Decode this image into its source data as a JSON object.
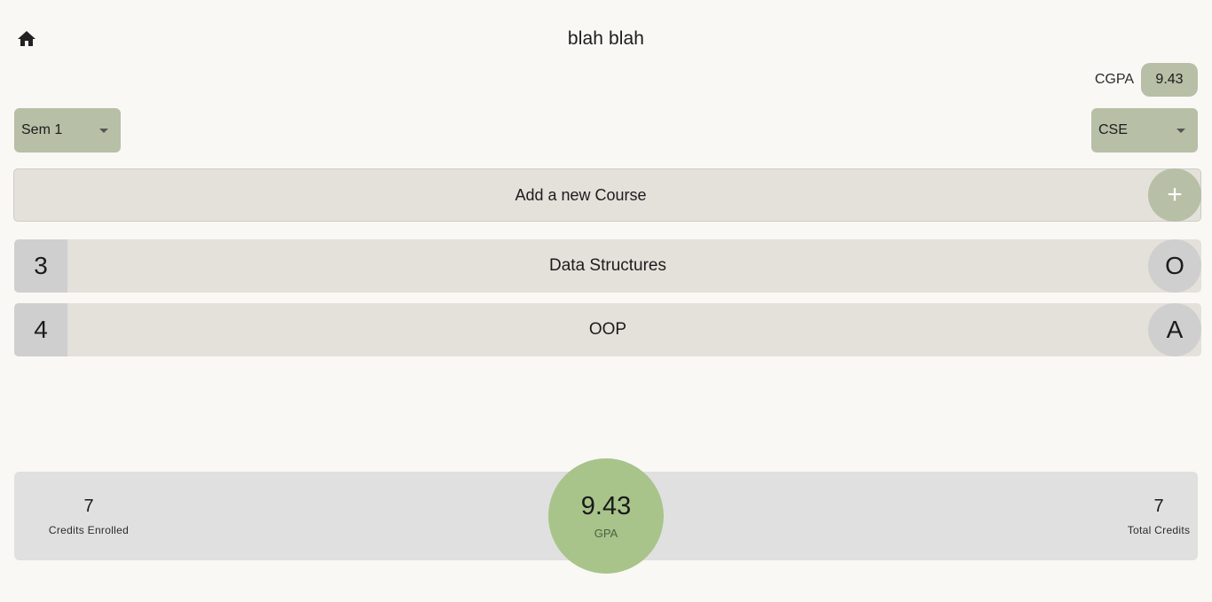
{
  "header": {
    "title": "blah blah",
    "home_icon": "home-icon"
  },
  "cgpa": {
    "label": "CGPA",
    "value": "9.43"
  },
  "filters": {
    "semester": {
      "value": "Sem 1"
    },
    "branch": {
      "value": "CSE"
    }
  },
  "add_course": {
    "label": "Add a new Course",
    "icon": "+"
  },
  "courses": [
    {
      "credits": "3",
      "name": "Data Structures",
      "grade": "O"
    },
    {
      "credits": "4",
      "name": "OOP",
      "grade": "A"
    }
  ],
  "summary": {
    "credits_enrolled": {
      "value": "7",
      "label": "Credits Enrolled"
    },
    "gpa": {
      "value": "9.43",
      "label": "GPA"
    },
    "total_credits": {
      "value": "7",
      "label": "Total Credits"
    }
  },
  "colors": {
    "background": "#f9f8f5",
    "accent": "#b7bfa6",
    "gpa_circle": "#a8c48a",
    "row": "#e4e1db",
    "badge": "#cfcfcf"
  }
}
